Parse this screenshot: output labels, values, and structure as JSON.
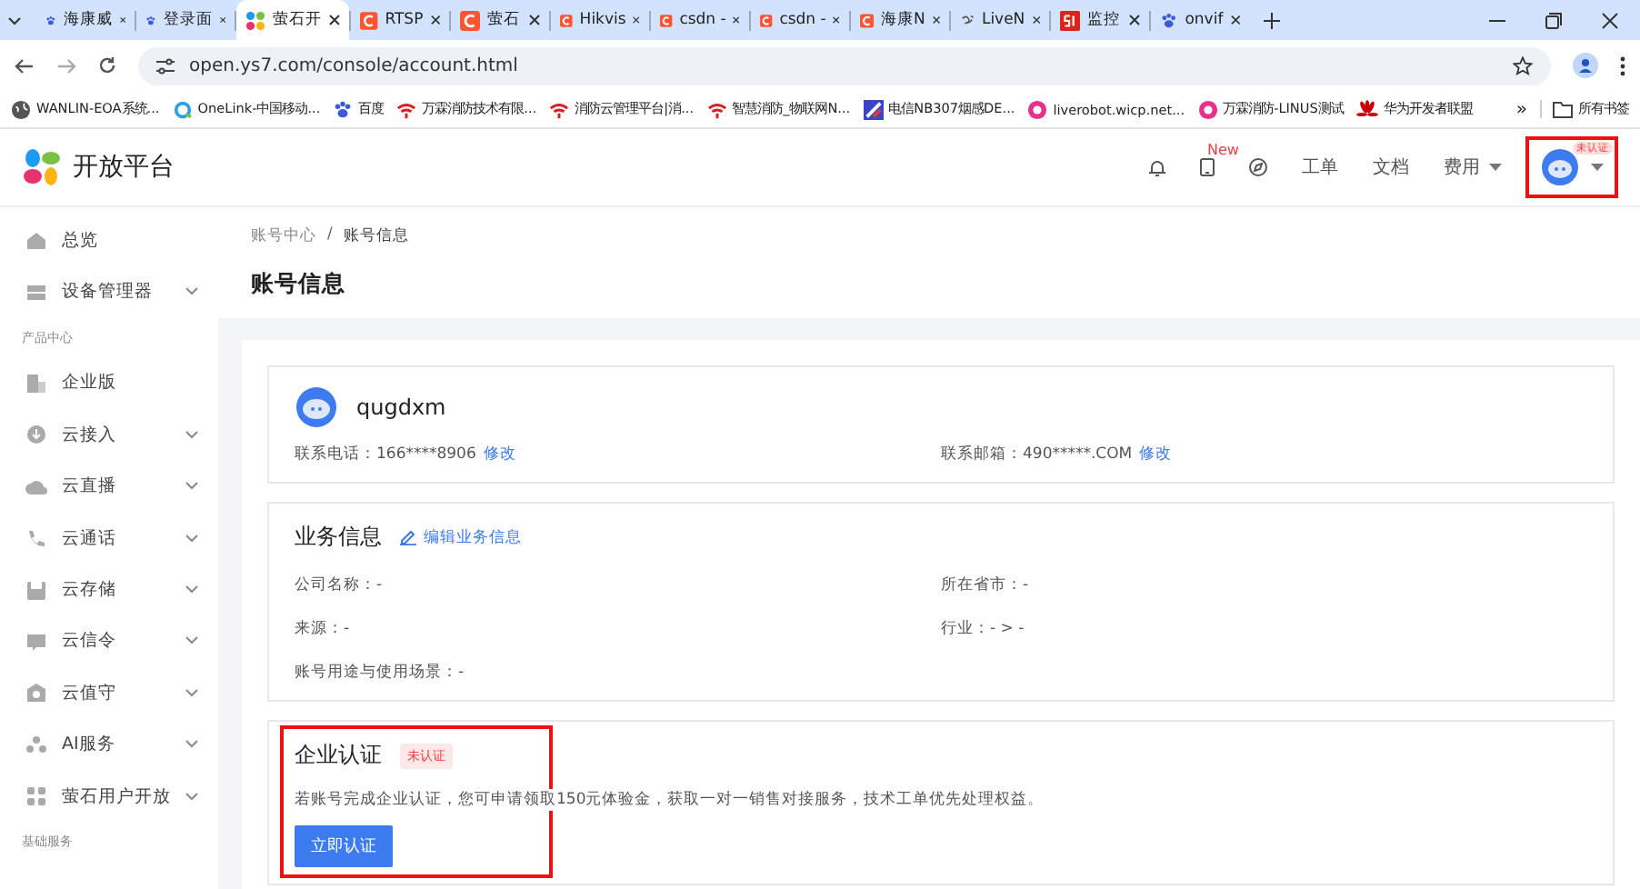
{
  "browser": {
    "tabs": [
      {
        "label": "海康威",
        "selected": false
      },
      {
        "label": "登录面",
        "selected": false
      },
      {
        "label": "萤石开",
        "selected": true
      },
      {
        "label": "RTSP",
        "selected": false
      },
      {
        "label": "萤石",
        "selected": false
      },
      {
        "label": "Hikvis",
        "selected": false
      },
      {
        "label": "csdn -",
        "selected": false
      },
      {
        "label": "csdn -",
        "selected": false
      },
      {
        "label": "海康N",
        "selected": false
      },
      {
        "label": "LiveN",
        "selected": false
      },
      {
        "label": "监控",
        "selected": false
      },
      {
        "label": "onvif",
        "selected": false
      }
    ],
    "url": "open.ys7.com/console/account.html",
    "bookmarks": [
      "WANLIN-EOA系统...",
      "OneLink-中国移动...",
      "百度",
      "万霖消防技术有限...",
      "消防云管理平台|消...",
      "智慧消防_物联网N...",
      "电信NB307烟感DE...",
      "liverobot.wicp.net...",
      "万霖消防-LINUS测试",
      "华为开发者联盟"
    ],
    "more": "»",
    "all_bookmarks": "所有书签"
  },
  "header": {
    "logo": "开放平台",
    "new_badge": "New",
    "links": [
      {
        "label": "工单",
        "dropdown": false
      },
      {
        "label": "文档",
        "dropdown": false
      },
      {
        "label": "费用",
        "dropdown": true
      }
    ],
    "avatar_badge": "未认证"
  },
  "sidebar": {
    "items": [
      {
        "kind": "item",
        "label": "总览",
        "expandable": false
      },
      {
        "kind": "item",
        "label": "设备管理器",
        "expandable": true
      },
      {
        "kind": "section",
        "label": "产品中心"
      },
      {
        "kind": "item",
        "label": "企业版",
        "expandable": false
      },
      {
        "kind": "item",
        "label": "云接入",
        "expandable": true
      },
      {
        "kind": "item",
        "label": "云直播",
        "expandable": true
      },
      {
        "kind": "item",
        "label": "云通话",
        "expandable": true
      },
      {
        "kind": "item",
        "label": "云存储",
        "expandable": true
      },
      {
        "kind": "item",
        "label": "云信令",
        "expandable": true
      },
      {
        "kind": "item",
        "label": "云值守",
        "expandable": true
      },
      {
        "kind": "item",
        "label": "AI服务",
        "expandable": true
      },
      {
        "kind": "item",
        "label": "萤石用户开放",
        "expandable": true
      },
      {
        "kind": "section",
        "label": "基础服务"
      }
    ]
  },
  "breadcrumb": {
    "items": [
      "账号中心",
      "账号信息"
    ],
    "separator": "/"
  },
  "page_title": "账号信息",
  "profile": {
    "username": "qugdxm",
    "phone_label": "联系电话：",
    "phone": "166****8906",
    "phone_edit": "修改",
    "email_label": "联系邮箱：",
    "email": "490*****.COM",
    "email_edit": "修改"
  },
  "business": {
    "title": "业务信息",
    "edit_link": "编辑业务信息",
    "fields": [
      "公司名称：-",
      "所在省市：-",
      "来源：-",
      "行业：- > -",
      "账号用途与使用场景：-"
    ]
  },
  "certification": {
    "title": "企业认证",
    "status": "未认证",
    "verified": false,
    "description": "若账号完成企业认证，您可申请领取150元体验金，获取一对一销售对接服务，技术工单优先处理权益。",
    "button": "立即认证"
  }
}
